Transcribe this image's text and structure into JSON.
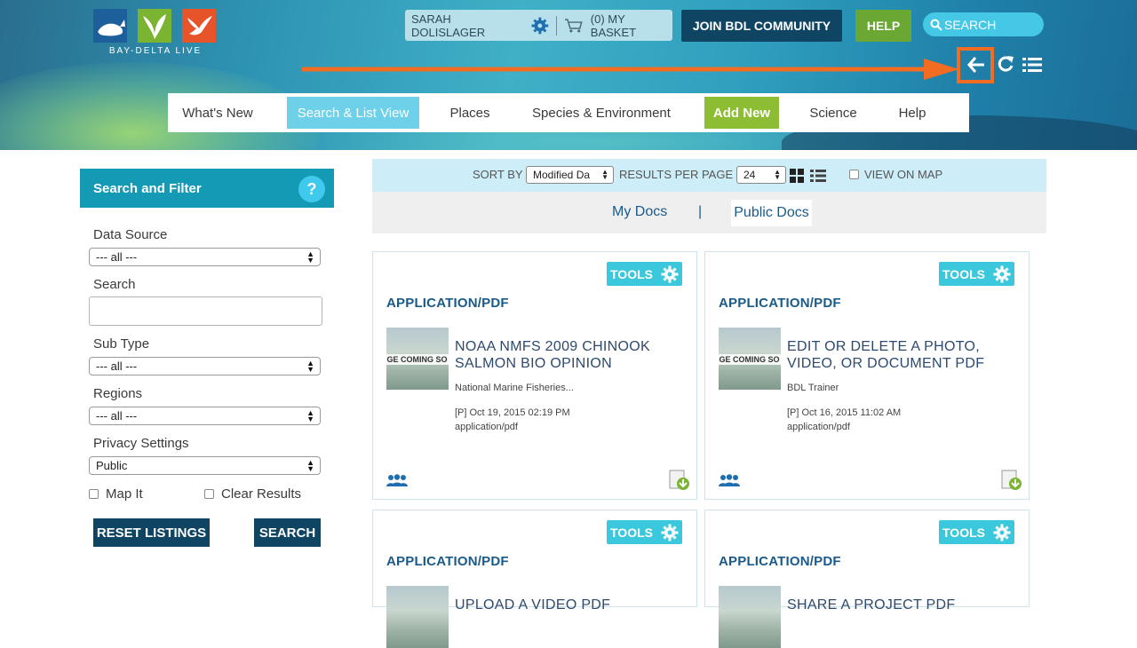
{
  "site": {
    "logo_text": "BAY-DELTA LIVE"
  },
  "topbar": {
    "user_name": "SARAH DOLISLAGER",
    "basket_label": "(0) MY BASKET",
    "join_label": "JOIN BDL COMMUNITY",
    "help_label": "HELP",
    "search_label": "SEARCH"
  },
  "nav": {
    "items": [
      "What's New",
      "Search & List View",
      "Places",
      "Species & Environment",
      "Add New",
      "Science",
      "Help"
    ]
  },
  "sidebar": {
    "title": "Search and Filter",
    "help_glyph": "?",
    "data_source_label": "Data Source",
    "data_source_value": "--- all ---",
    "search_label": "Search",
    "search_value": "",
    "subtype_label": "Sub Type",
    "subtype_value": "--- all ---",
    "regions_label": "Regions",
    "regions_value": "--- all ---",
    "privacy_label": "Privacy Settings",
    "privacy_value": "Public",
    "map_it_label": "Map It",
    "clear_results_label": "Clear Results",
    "reset_label": "RESET LISTINGS",
    "search_button_label": "SEARCH"
  },
  "results_toolbar": {
    "sort_label": "SORT BY",
    "sort_value": "Modified Da",
    "per_page_label": "RESULTS PER PAGE",
    "per_page_value": "24",
    "view_on_map_label": "VIEW ON MAP"
  },
  "docs_tabs": {
    "my_docs": "My Docs",
    "separator": "|",
    "public_docs": "Public Docs"
  },
  "cards": [
    {
      "tools": "TOOLS",
      "type": "APPLICATION/PDF",
      "thumb_text": "AGE COMING SO",
      "title": "NOAA NMFS 2009 CHINOOK SALMON BIO OPINION",
      "author": "National Marine Fisheries...",
      "date": "[P] Oct 19, 2015 02:19 PM",
      "mime": "application/pdf"
    },
    {
      "tools": "TOOLS",
      "type": "APPLICATION/PDF",
      "thumb_text": "AGE COMING SO",
      "title": "EDIT OR DELETE A PHOTO, VIDEO, OR DOCUMENT PDF",
      "author": "BDL Trainer",
      "date": "[P] Oct 16, 2015 11:02 AM",
      "mime": "application/pdf"
    },
    {
      "tools": "TOOLS",
      "type": "APPLICATION/PDF",
      "title": "UPLOAD A VIDEO PDF"
    },
    {
      "tools": "TOOLS",
      "type": "APPLICATION/PDF",
      "title": "SHARE A PROJECT PDF"
    }
  ],
  "colors": {
    "accent_orange": "#f26c22",
    "dark_blue": "#0f4562",
    "teal": "#159ab6",
    "green": "#6aa833"
  }
}
